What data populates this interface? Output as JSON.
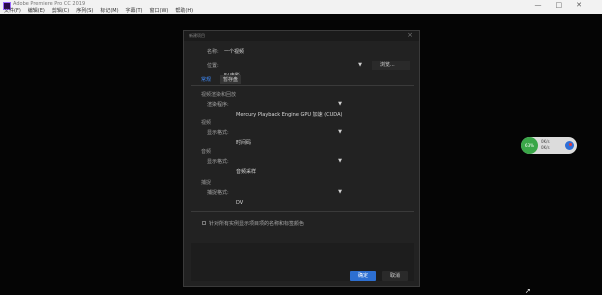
{
  "window": {
    "title": "Adobe Premiere Pro CC 2019",
    "controls": [
      "—",
      "□",
      "✕"
    ]
  },
  "menu": [
    "文件(F)",
    "编辑(E)",
    "剪辑(C)",
    "序列(S)",
    "标记(M)",
    "字幕(T)",
    "窗口(W)",
    "帮助(H)"
  ],
  "dialog": {
    "title": "新建项目",
    "name_label": "名称:",
    "name_value": "一个视频",
    "location_label": "位置:",
    "location_value": "F:\\电影",
    "browse_button": "浏览...",
    "tabs": [
      "常规",
      "暂存盘"
    ],
    "active_tab": 0,
    "sections": {
      "render": {
        "title": "视频渲染和回放",
        "label": "渲染程序:",
        "value": "Mercury Playback Engine GPU 加速 (CUDA)"
      },
      "video": {
        "title": "视频",
        "label": "显示格式:",
        "value": "时间码"
      },
      "audio": {
        "title": "音频",
        "label": "显示格式:",
        "value": "音频采样"
      },
      "capture": {
        "title": "捕捉",
        "label": "捕捉格式:",
        "value": "DV"
      }
    },
    "checkbox_label": "针对所有实例显示项目项的名称和标签颜色",
    "ok_button": "确定",
    "cancel_button": "取消"
  },
  "net_widget": {
    "percent": "63%",
    "upload": "0K/s",
    "download": "0K/s"
  }
}
